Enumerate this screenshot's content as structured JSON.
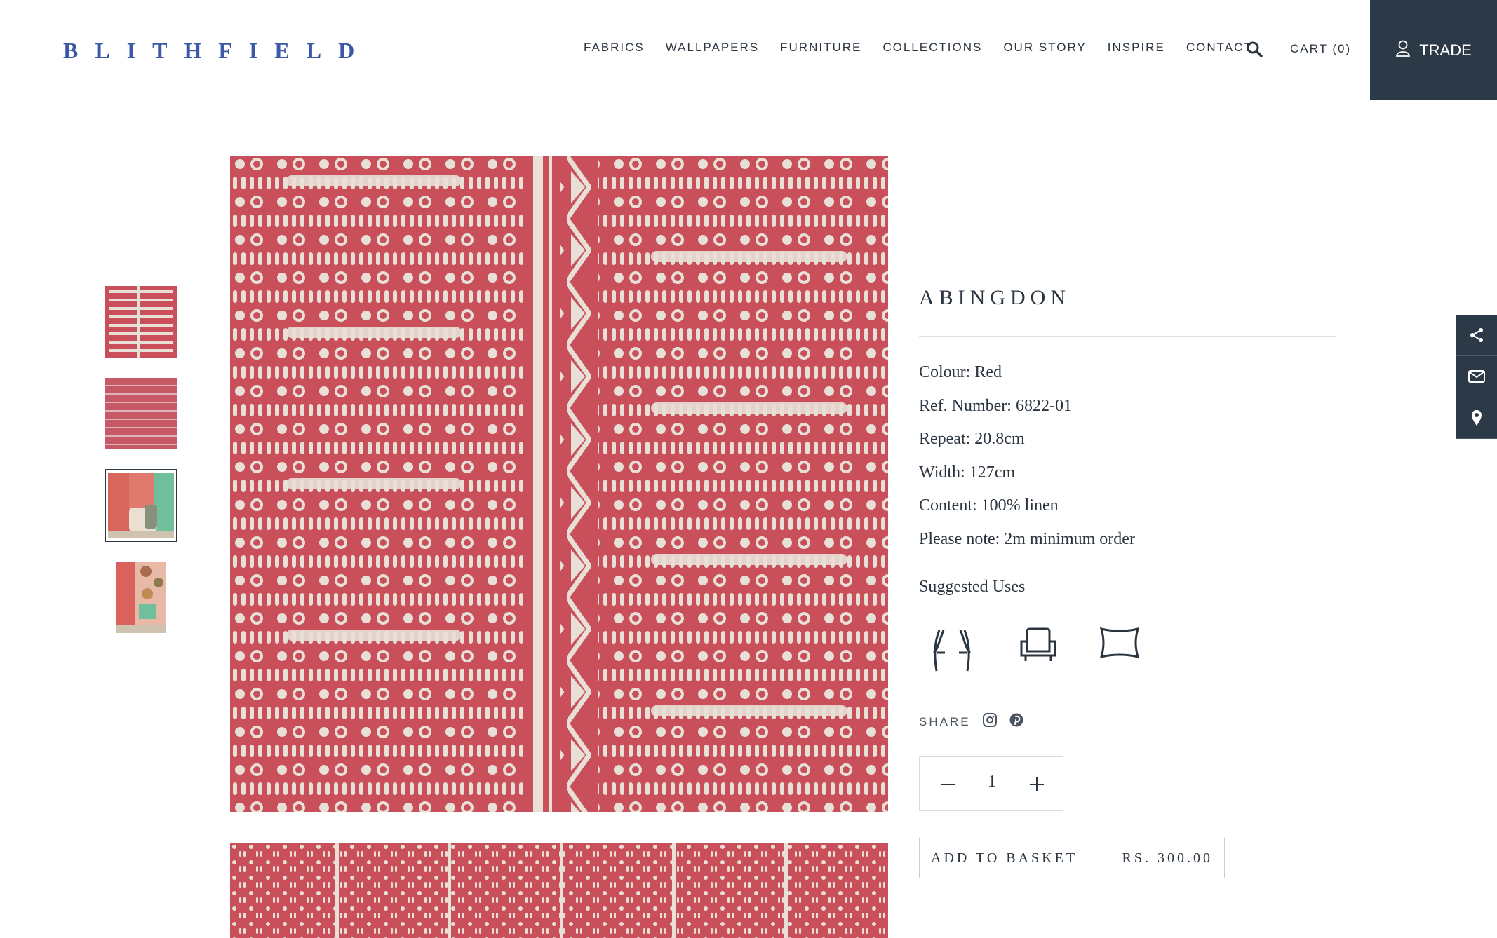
{
  "brand": {
    "logo_text": "BLITHFIELD",
    "color": "#3c56a8"
  },
  "nav": {
    "items": [
      "FABRICS",
      "WALLPAPERS",
      "FURNITURE",
      "COLLECTIONS",
      "OUR STORY",
      "INSPIRE",
      "CONTACT"
    ],
    "search_icon": "search-icon",
    "cart_label": "CART (0)",
    "trade_label": "TRADE",
    "trade_icon": "user-icon"
  },
  "product": {
    "title": "ABINGDON",
    "specs": [
      "Colour: Red",
      "Ref. Number: 6822-01",
      "Repeat: 20.8cm",
      "Width: 127cm",
      "Content: 100% linen",
      "Please note: 2m minimum order"
    ],
    "suggested_uses_label": "Suggested Uses",
    "suggested_uses_icons": [
      "curtains-icon",
      "armchair-icon",
      "cushion-icon"
    ],
    "share_label": "SHARE",
    "share_icons": [
      "instagram-icon",
      "pinterest-icon"
    ],
    "quantity": "1",
    "add_to_basket_label": "ADD TO BASKET",
    "price": "RS. 300.00",
    "fabric_color": "#c9505b",
    "pattern_color": "#e8e0d6"
  },
  "gallery": {
    "thumbnail_count": 4,
    "active_thumbnail": 3
  },
  "side_actions": [
    "share-icon",
    "mail-icon",
    "map-pin-icon"
  ],
  "accent_dark": "#2c3a47"
}
